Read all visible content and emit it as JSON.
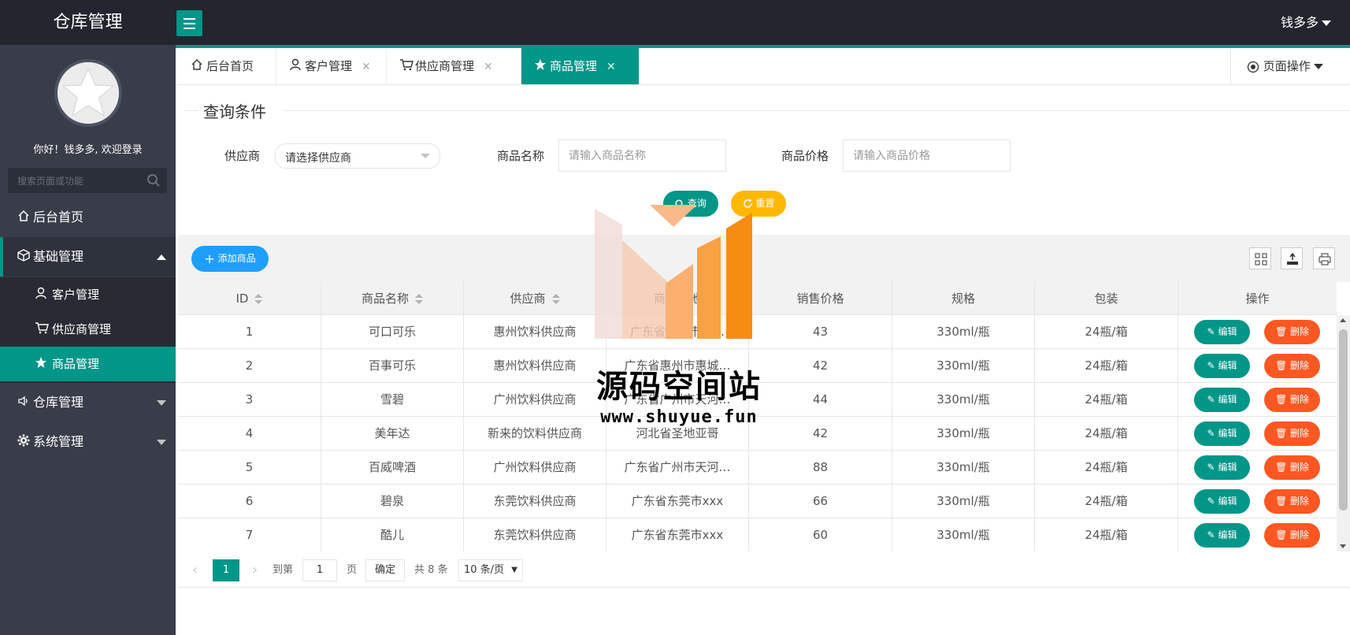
{
  "app": {
    "title": "仓库管理"
  },
  "header": {
    "user_name": "钱多多"
  },
  "sidebar": {
    "greeting": "你好！钱多多, 欢迎登录",
    "search_placeholder": "搜索页面或功能",
    "items": [
      {
        "label": "后台首页",
        "icon": "home-icon"
      },
      {
        "label": "基础管理",
        "icon": "cube-icon",
        "expanded": true,
        "children": [
          {
            "label": "客户管理",
            "icon": "user-icon"
          },
          {
            "label": "供应商管理",
            "icon": "cart-icon"
          },
          {
            "label": "商品管理",
            "icon": "star-icon",
            "active": true
          }
        ]
      },
      {
        "label": "仓库管理",
        "icon": "speaker-icon"
      },
      {
        "label": "系统管理",
        "icon": "gear-icon"
      }
    ]
  },
  "tabs": [
    {
      "label": "后台首页",
      "icon": "home-icon",
      "closable": false
    },
    {
      "label": "客户管理",
      "icon": "user-icon",
      "closable": true
    },
    {
      "label": "供应商管理",
      "icon": "cart-icon",
      "closable": true
    },
    {
      "label": "商品管理",
      "icon": "star-icon",
      "closable": true,
      "active": true
    }
  ],
  "page_ops": {
    "label": "页面操作"
  },
  "query": {
    "title": "查询条件",
    "supplier_label": "供应商",
    "supplier_value": "请选择供应商",
    "name_label": "商品名称",
    "name_placeholder": "请输入商品名称",
    "price_label": "商品价格",
    "price_placeholder": "请输入商品价格",
    "search_button": "查询",
    "reset_button": "重置"
  },
  "toolbar": {
    "add_button": "添加商品"
  },
  "table": {
    "columns": [
      "ID",
      "商品名称",
      "供应商",
      "商品产地",
      "销售价格",
      "规格",
      "包装",
      "操作"
    ],
    "edit_label": "编辑",
    "delete_label": "删除",
    "rows": [
      {
        "id": "1",
        "name": "可口可乐",
        "supplier": "惠州饮料供应商",
        "origin": "广东省惠州市惠…",
        "price": "43",
        "spec": "330ml/瓶",
        "pack": "24瓶/箱"
      },
      {
        "id": "2",
        "name": "百事可乐",
        "supplier": "惠州饮料供应商",
        "origin": "广东省惠州市惠城…",
        "price": "42",
        "spec": "330ml/瓶",
        "pack": "24瓶/箱"
      },
      {
        "id": "3",
        "name": "雪碧",
        "supplier": "广州饮料供应商",
        "origin": "广东省广州市天河…",
        "price": "44",
        "spec": "330ml/瓶",
        "pack": "24瓶/箱"
      },
      {
        "id": "4",
        "name": "美年达",
        "supplier": "新来的饮料供应商",
        "origin": "河北省圣地亚哥",
        "price": "42",
        "spec": "330ml/瓶",
        "pack": "24瓶/箱"
      },
      {
        "id": "5",
        "name": "百威啤酒",
        "supplier": "广州饮料供应商",
        "origin": "广东省广州市天河…",
        "price": "88",
        "spec": "330ml/瓶",
        "pack": "24瓶/箱"
      },
      {
        "id": "6",
        "name": "碧泉",
        "supplier": "东莞饮料供应商",
        "origin": "广东省东莞市xxx",
        "price": "66",
        "spec": "330ml/瓶",
        "pack": "24瓶/箱"
      },
      {
        "id": "7",
        "name": "酷儿",
        "supplier": "东莞饮料供应商",
        "origin": "广东省东莞市xxx",
        "price": "60",
        "spec": "330ml/瓶",
        "pack": "24瓶/箱"
      }
    ]
  },
  "pagination": {
    "current_page": "1",
    "goto_label": "到第",
    "goto_value": "1",
    "page_unit": "页",
    "confirm": "确定",
    "total": "共 8 条",
    "page_size": "10 条/页"
  },
  "watermark": {
    "text": "源码空间站",
    "url": "www.shuyue.fun"
  },
  "colors": {
    "primary": "#009688",
    "header": "#23262e",
    "sidebar": "#393d49",
    "blue": "#1e9fff",
    "danger": "#ff5722",
    "warm": "#ffb800"
  }
}
